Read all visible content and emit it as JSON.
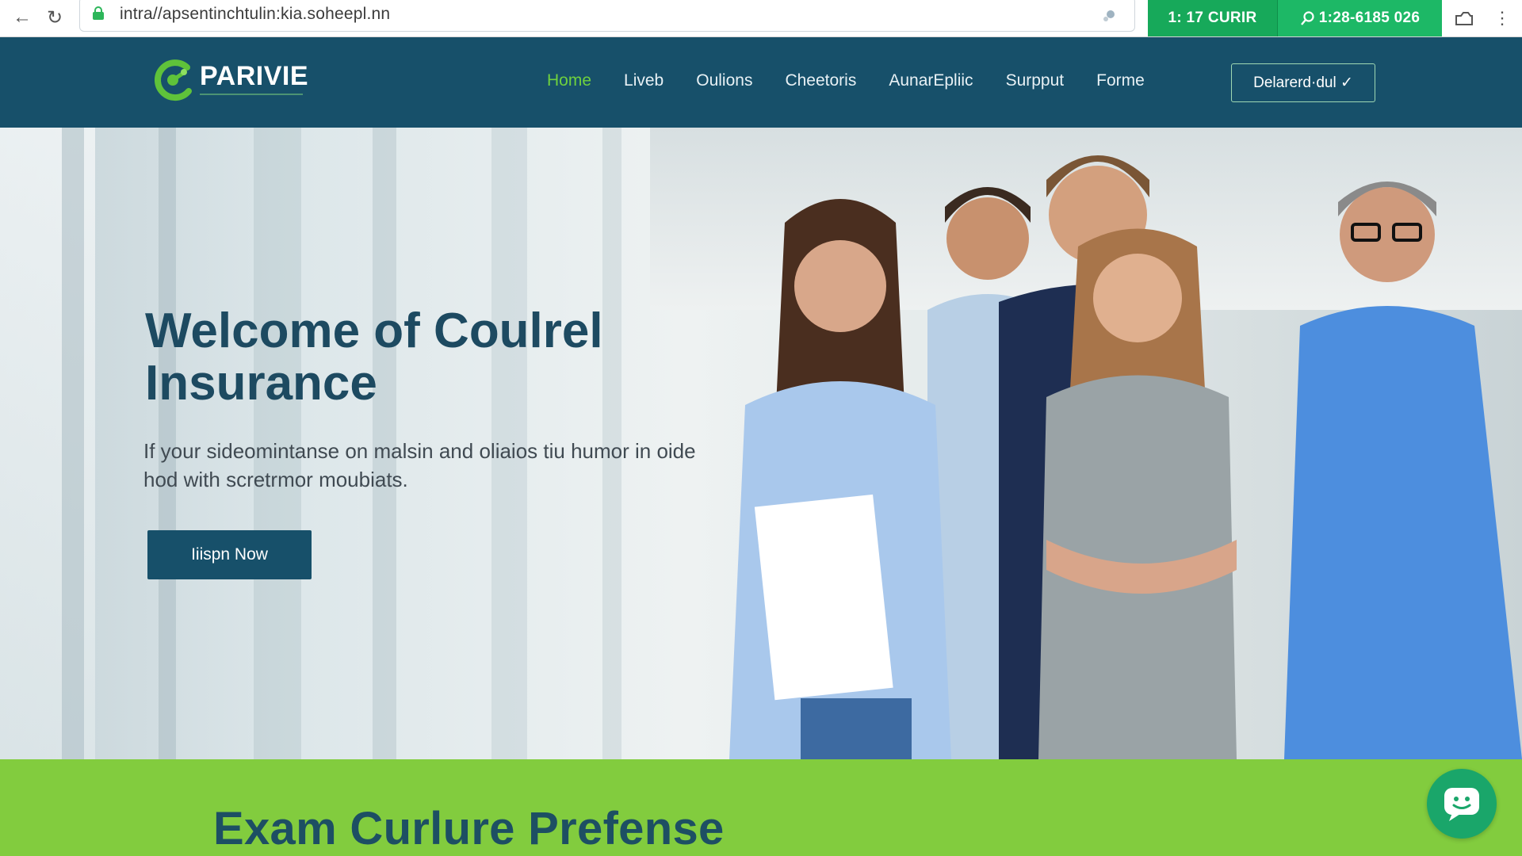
{
  "browser": {
    "url": "intra//apsentinchtulin:kia.soheepl.nn",
    "chip_left": "1: 17 CURIR",
    "chip_right": "1:28-6185 026"
  },
  "header": {
    "logo_name": "PARIVIE",
    "nav": [
      "Home",
      "Liveb",
      "Oulions",
      "Cheetoris",
      "AunarEpliic",
      "Surpput",
      "Forme"
    ],
    "active_nav": "Home",
    "cta": "Delarerd·dul ✓"
  },
  "hero": {
    "title": "Welcome of Coulrel Insurance",
    "subtitle": "If your sideomintanse on malsin and oliaios tiu humor in oide hod with scretrmor moubiats.",
    "button": "Iiispn Now"
  },
  "band": {
    "title": "Exam Curlure Prefense"
  },
  "colors": {
    "header_bg": "#17506a",
    "accent_green": "#6fd13e",
    "band_green": "#82cc3e",
    "chip_green": "#17a95a",
    "title_blue": "#1d4a61"
  }
}
